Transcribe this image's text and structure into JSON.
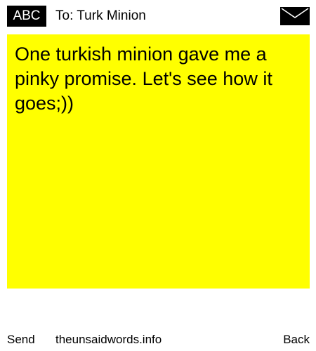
{
  "header": {
    "badge_label": "ABC",
    "to_text": "To: Turk Minion",
    "envelope_icon": "envelope-icon"
  },
  "note": {
    "text": "One turkish minion gave me a pinky promise. Let's see how it goes;))",
    "background_color": "#ffff00"
  },
  "footer": {
    "send_label": "Send",
    "site_label": "theunsaidwords.info",
    "back_label": "Back"
  }
}
